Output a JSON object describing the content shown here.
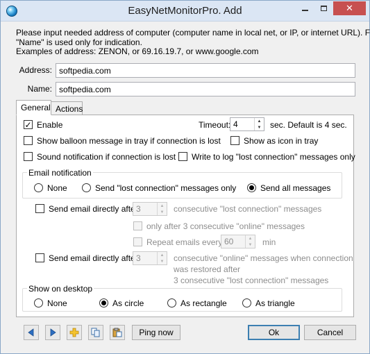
{
  "window": {
    "title": "EasyNetMonitorPro. Add",
    "close_glyph": "✕"
  },
  "intro": {
    "line1": "Please input needed address of computer (computer name in local net, or IP, or internet URL). Field",
    "line2": "\"Name\" is used only for indication.",
    "line3": "Examples of address:   ZENON, or  69.16.19.7,  or www.google.com"
  },
  "address": {
    "label": "Address:",
    "value": "softpedia.com"
  },
  "name": {
    "label": "Name:",
    "value": "softpedia.com"
  },
  "tabs": [
    {
      "label": "General",
      "active": true
    },
    {
      "label": "Actions",
      "active": false
    }
  ],
  "general": {
    "enable": {
      "label": "Enable",
      "checked": true
    },
    "timeout": {
      "label": "Timeout:",
      "value": "4",
      "suffix": "sec. Default is 4 sec."
    },
    "balloon": {
      "label": "Show balloon message in tray if connection is lost",
      "checked": false
    },
    "show_icon_tray": {
      "label": "Show as icon in tray",
      "checked": false
    },
    "sound": {
      "label": "Sound notification if connection is lost",
      "checked": false
    },
    "write_log": {
      "label": "Write to log \"lost connection\" messages only",
      "checked": false
    }
  },
  "email_notification": {
    "title": "Email notification",
    "options": [
      {
        "label": "None",
        "selected": false
      },
      {
        "label": "Send \"lost connection\" messages only",
        "selected": false
      },
      {
        "label": "Send all messages",
        "selected": true
      }
    ],
    "send_direct_1": {
      "label": "Send email directly after",
      "value": "3",
      "suffix": "consecutive \"lost connection\" messages"
    },
    "only_after": {
      "label": "only after 3 consecutive \"online\" messages"
    },
    "repeat": {
      "label": "Repeat emails every",
      "value": "60",
      "suffix": "min"
    },
    "send_direct_2": {
      "label": "Send email directly after",
      "value": "3",
      "suffix_line1": "consecutive \"online\" messages when connection",
      "suffix_line2": "was restored after",
      "suffix_line3": "3 consecutive \"lost connection\" messages"
    }
  },
  "show_on_desktop": {
    "title": "Show on desktop",
    "options": [
      {
        "label": "None",
        "selected": false
      },
      {
        "label": "As circle",
        "selected": true
      },
      {
        "label": "As rectangle",
        "selected": false
      },
      {
        "label": "As triangle",
        "selected": false
      }
    ]
  },
  "footer": {
    "ping_label": "Ping now",
    "ok_label": "Ok",
    "cancel_label": "Cancel"
  },
  "colors": {
    "accent": "#3c7fb1",
    "close_button": "#c75050",
    "titlebar": "#dbe6f4"
  }
}
